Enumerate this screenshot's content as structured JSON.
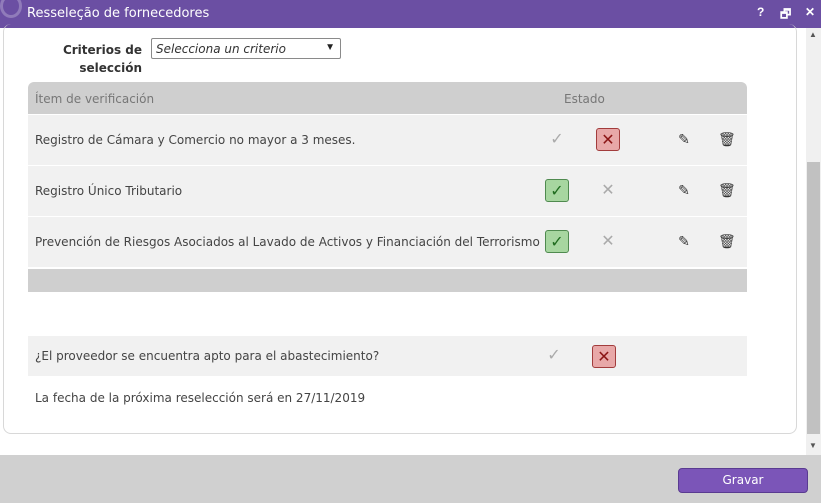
{
  "window": {
    "title": "Resseleção de fornecedores",
    "help_label": "?",
    "restore_label": "🗗",
    "close_label": "✕"
  },
  "criteria": {
    "label": "Criterios de selección",
    "placeholder": "Selecciona un criterio"
  },
  "table": {
    "headers": [
      "Ítem de verificación",
      "Estado"
    ],
    "rows": [
      {
        "item": "Registro de Cámara y Comercio no mayor a 3 meses.",
        "state": "rejected"
      },
      {
        "item": "Registro Único Tributario",
        "state": "approved"
      },
      {
        "item": "Prevención de Riesgos Asociados al Lavado de Activos y Financiación del Terrorismo",
        "state": "approved"
      }
    ]
  },
  "question": {
    "text": "¿El proveedor se encuentra apto para el abastecimiento?",
    "state": "rejected"
  },
  "next_date_text": "La fecha de la próxima reselección será en 27/11/2019",
  "icons": {
    "check": "✓",
    "cross": "✕",
    "edit": "✎",
    "delete": "🗑"
  },
  "colors": {
    "title_bar": "#6b4fa3",
    "approved_fill": "#a7d6a0",
    "rejected_fill": "#e8a8a8",
    "save_button": "#7b55b8"
  },
  "footer": {
    "save_label": "Gravar"
  }
}
